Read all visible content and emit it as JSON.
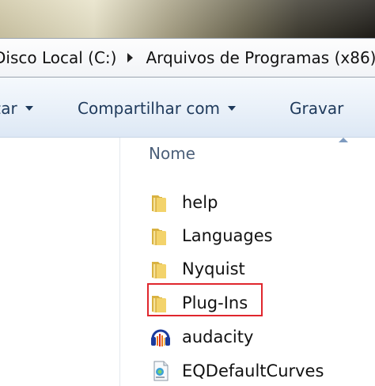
{
  "address": {
    "crumbs": [
      "Disco Local (C:)",
      "Arquivos de Programas (x86)"
    ]
  },
  "toolbar": {
    "organize_label": "Organizar",
    "share_label": "Compartilhar com",
    "burn_label": "Gravar"
  },
  "file_list": {
    "column_header": "Nome",
    "items": [
      {
        "name": "help",
        "icon": "folder-icon"
      },
      {
        "name": "Languages",
        "icon": "folder-icon"
      },
      {
        "name": "Nyquist",
        "icon": "folder-icon"
      },
      {
        "name": "Plug-Ins",
        "icon": "folder-icon"
      },
      {
        "name": "audacity",
        "icon": "audacity-icon"
      },
      {
        "name": "EQDefaultCurves",
        "icon": "xml-document-icon"
      }
    ]
  },
  "colors": {
    "highlight": "#e0262d",
    "toolbar_text": "#1e395b",
    "header_text": "#4c607a",
    "folder_yellow": "#f3d36b"
  }
}
